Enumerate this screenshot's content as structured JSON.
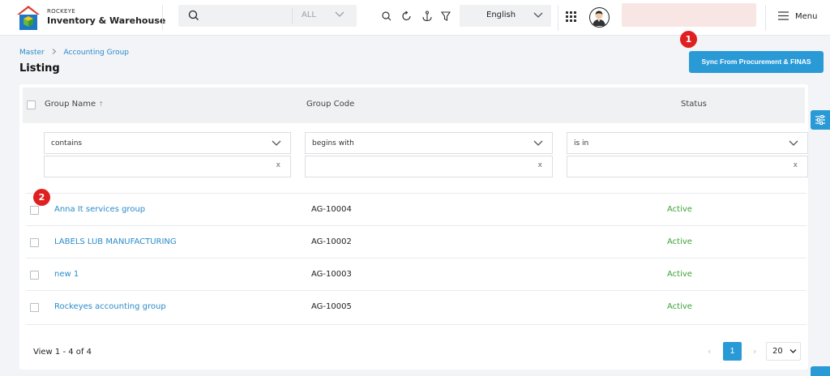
{
  "header": {
    "brand_top": "ROCKEYE",
    "brand_main": "Inventory & Warehouse",
    "search_scope": "ALL",
    "language": "English",
    "menu_label": "Menu"
  },
  "breadcrumb": {
    "items": [
      "Master",
      "Accounting Group"
    ]
  },
  "page_title": "Listing",
  "sync_button_label": "Sync From Procurement & FINAS",
  "badges": [
    "1",
    "2"
  ],
  "table": {
    "columns": [
      "Group Name",
      "Group Code",
      "Status"
    ],
    "filters": [
      "contains",
      "begins with",
      "is in"
    ],
    "clear_symbol": "x",
    "rows": [
      {
        "name": "Anna It services group",
        "code": "AG-10004",
        "status": "Active"
      },
      {
        "name": "LABELS LUB MANUFACTURING",
        "code": "AG-10002",
        "status": "Active"
      },
      {
        "name": "new 1",
        "code": "AG-10003",
        "status": "Active"
      },
      {
        "name": "Rockeyes accounting group",
        "code": "AG-10005",
        "status": "Active"
      }
    ]
  },
  "pagination": {
    "view_text": "View 1 - 4 of 4",
    "current_page": "1",
    "page_size": "20"
  },
  "colors": {
    "accent": "#2a9ad6",
    "link": "#2a8bc9",
    "status_active": "#3aa335",
    "badge": "#e02020"
  }
}
